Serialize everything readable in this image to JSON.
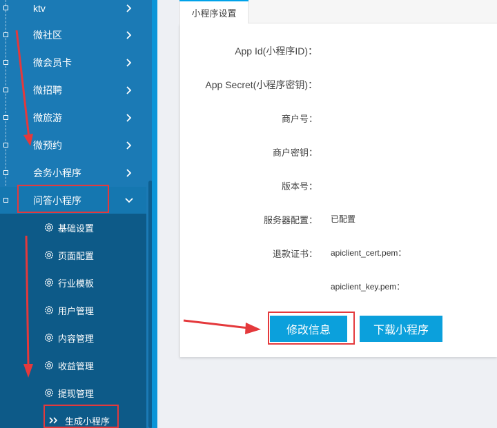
{
  "sidebar": {
    "menu": [
      {
        "label": "ktv"
      },
      {
        "label": "微社区"
      },
      {
        "label": "微会员卡"
      },
      {
        "label": "微招聘"
      },
      {
        "label": "微旅游"
      },
      {
        "label": "微预约"
      },
      {
        "label": "会务小程序"
      },
      {
        "label": "问答小程序"
      }
    ],
    "submenu": [
      {
        "label": "基础设置",
        "icon": "gear-icon"
      },
      {
        "label": "页面配置",
        "icon": "gear-icon"
      },
      {
        "label": "行业模板",
        "icon": "gear-icon"
      },
      {
        "label": "用户管理",
        "icon": "gear-icon"
      },
      {
        "label": "内容管理",
        "icon": "gear-icon"
      },
      {
        "label": "收益管理",
        "icon": "gear-icon"
      },
      {
        "label": "提现管理",
        "icon": "gear-icon"
      },
      {
        "label": "生成小程序",
        "icon": "double-chevron-right-icon"
      }
    ]
  },
  "main": {
    "tab": "小程序设置",
    "fields": [
      {
        "label": "App Id(小程序ID)：",
        "value": ""
      },
      {
        "label": "App Secret(小程序密钥)：",
        "value": ""
      },
      {
        "label": "商户号：",
        "value": ""
      },
      {
        "label": "商户密钥：",
        "value": ""
      },
      {
        "label": "版本号：",
        "value": ""
      },
      {
        "label": "服务器配置：",
        "value": "已配置"
      },
      {
        "label": "退款证书：",
        "value": "apiclient_cert.pem："
      },
      {
        "label": "",
        "value": "apiclient_key.pem："
      }
    ],
    "buttons": {
      "edit": "修改信息",
      "download": "下载小程序"
    }
  },
  "colors": {
    "sidebar": "#1b7ab5",
    "submenu": "#0d5a88",
    "accent": "#0ba0dc",
    "annotation": "#e4393c"
  }
}
